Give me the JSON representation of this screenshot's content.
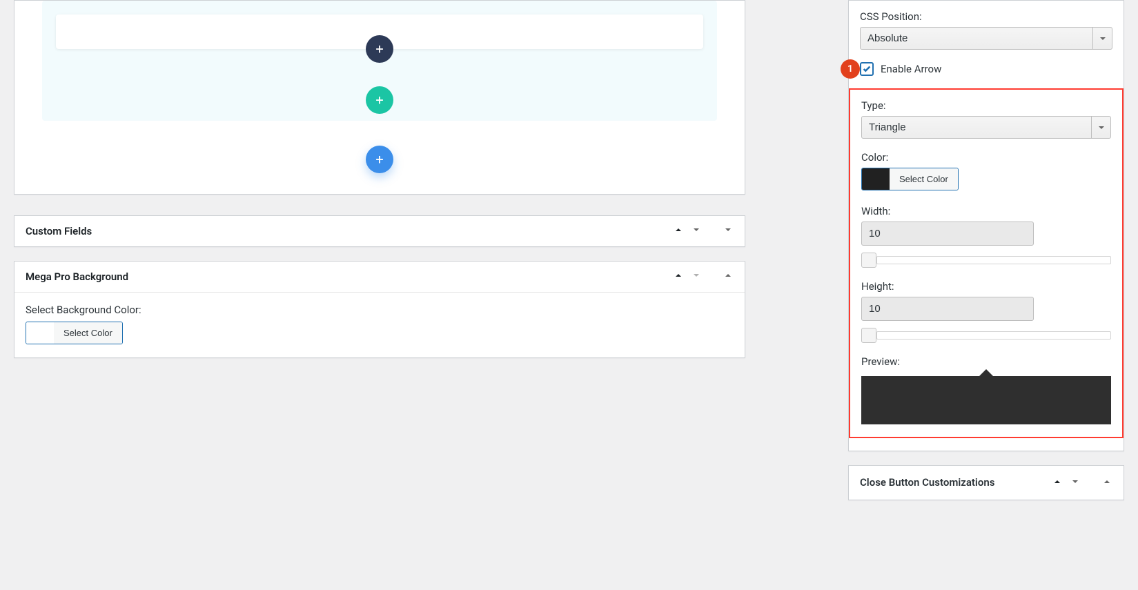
{
  "builder": {
    "add_icon": "+"
  },
  "custom_fields": {
    "title": "Custom Fields"
  },
  "mega_bg": {
    "title": "Mega Pro Background",
    "select_bg_label": "Select Background Color:",
    "select_color_btn": "Select Color"
  },
  "sidebar": {
    "css_position_label": "CSS Position:",
    "css_position_value": "Absolute",
    "enable_arrow_label": "Enable Arrow",
    "badge": "1",
    "type_label": "Type:",
    "type_value": "Triangle",
    "color_label": "Color:",
    "select_color_btn": "Select Color",
    "width_label": "Width:",
    "width_value": "10",
    "height_label": "Height:",
    "height_value": "10",
    "preview_label": "Preview:"
  },
  "close_button": {
    "title": "Close Button Customizations"
  }
}
